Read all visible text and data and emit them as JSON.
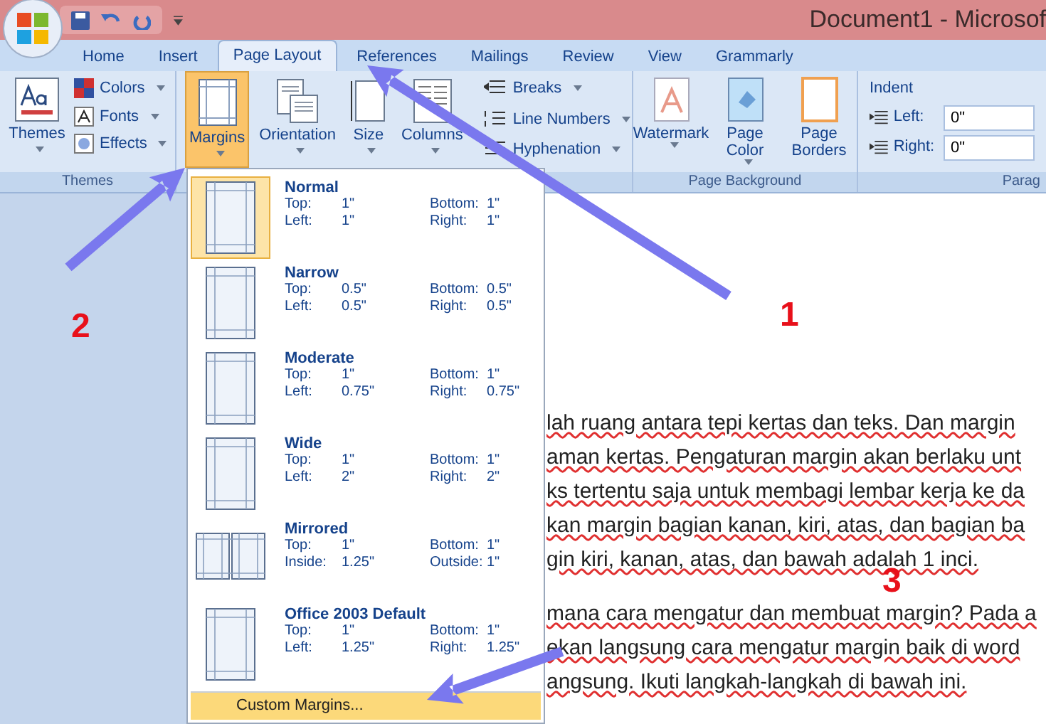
{
  "window": {
    "title": "Document1 - Microsof"
  },
  "tabs": [
    {
      "label": "Home",
      "selected": false
    },
    {
      "label": "Insert",
      "selected": false
    },
    {
      "label": "Page Layout",
      "selected": true
    },
    {
      "label": "References",
      "selected": false
    },
    {
      "label": "Mailings",
      "selected": false
    },
    {
      "label": "Review",
      "selected": false
    },
    {
      "label": "View",
      "selected": false
    },
    {
      "label": "Grammarly",
      "selected": false
    }
  ],
  "ribbon": {
    "themes_group": {
      "label": "Themes",
      "big_button": "Themes",
      "small_buttons": [
        "Colors",
        "Fonts",
        "Effects"
      ]
    },
    "page_setup": {
      "big_buttons": [
        {
          "label": "Margins",
          "selected": true
        },
        {
          "label": "Orientation",
          "selected": false
        },
        {
          "label": "Size",
          "selected": false
        },
        {
          "label": "Columns",
          "selected": false
        }
      ],
      "small_buttons": [
        "Breaks",
        "Line Numbers",
        "Hyphenation"
      ]
    },
    "page_background": {
      "label": "Page Background",
      "buttons": [
        {
          "label": "Watermark",
          "kind": "watermark"
        },
        {
          "label": "Page Color",
          "kind": "color"
        },
        {
          "label": "Page Borders",
          "kind": "borders"
        }
      ]
    },
    "paragraph": {
      "label": "Parag",
      "heading": "Indent",
      "fields": [
        {
          "label": "Left:",
          "value": "0\""
        },
        {
          "label": "Right:",
          "value": "0\""
        }
      ]
    }
  },
  "margins_menu": {
    "items": [
      {
        "name": "Normal",
        "kind": "single",
        "selected": true,
        "fields": [
          [
            "Top:",
            "1\""
          ],
          [
            "Bottom:",
            "1\""
          ],
          [
            "Left:",
            "1\""
          ],
          [
            "Right:",
            "1\""
          ]
        ]
      },
      {
        "name": "Narrow",
        "kind": "single",
        "selected": false,
        "fields": [
          [
            "Top:",
            "0.5\""
          ],
          [
            "Bottom:",
            "0.5\""
          ],
          [
            "Left:",
            "0.5\""
          ],
          [
            "Right:",
            "0.5\""
          ]
        ]
      },
      {
        "name": "Moderate",
        "kind": "single",
        "selected": false,
        "fields": [
          [
            "Top:",
            "1\""
          ],
          [
            "Bottom:",
            "1\""
          ],
          [
            "Left:",
            "0.75\""
          ],
          [
            "Right:",
            "0.75\""
          ]
        ]
      },
      {
        "name": "Wide",
        "kind": "single",
        "selected": false,
        "fields": [
          [
            "Top:",
            "1\""
          ],
          [
            "Bottom:",
            "1\""
          ],
          [
            "Left:",
            "2\""
          ],
          [
            "Right:",
            "2\""
          ]
        ]
      },
      {
        "name": "Mirrored",
        "kind": "mirrored",
        "selected": false,
        "fields": [
          [
            "Top:",
            "1\""
          ],
          [
            "Bottom:",
            "1\""
          ],
          [
            "Inside:",
            "1.25\""
          ],
          [
            "Outside:",
            "1\""
          ]
        ]
      },
      {
        "name": "Office 2003 Default",
        "kind": "single",
        "selected": false,
        "fields": [
          [
            "Top:",
            "1\""
          ],
          [
            "Bottom:",
            "1\""
          ],
          [
            "Left:",
            "1.25\""
          ],
          [
            "Right:",
            "1.25\""
          ]
        ]
      }
    ],
    "custom": "Custom Margins..."
  },
  "document": {
    "paragraphs": [
      [
        "lah ruang antara tepi kertas dan teks. Dan margin",
        "aman kertas. Pengaturan margin akan berlaku unt",
        "ks tertentu saja untuk membagi lembar kerja ke da",
        "kan margin bagian kanan, kiri, atas, dan bagian ba",
        "gin kiri, kanan, atas, dan bawah adalah 1 inci."
      ],
      [
        "mana cara mengatur dan membuat margin? Pada a",
        "ekan langsung cara mengatur margin baik di word",
        "angsung. Ikuti langkah-langkah di bawah ini."
      ]
    ]
  },
  "annotations": [
    {
      "number": "1"
    },
    {
      "number": "2"
    },
    {
      "number": "3"
    }
  ]
}
